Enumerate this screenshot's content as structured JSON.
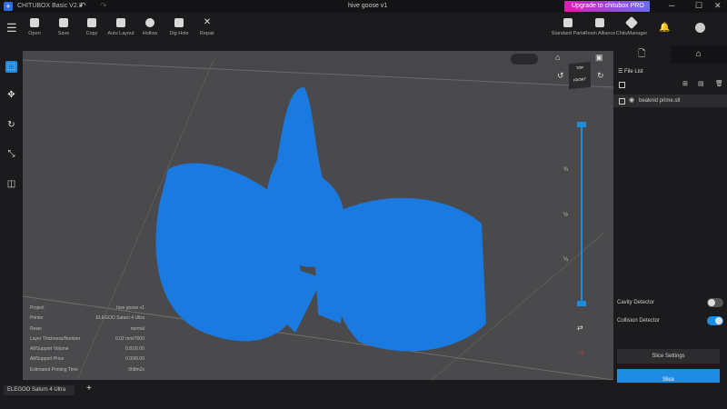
{
  "title_bar": {
    "app_name": "CHITUBOX Basic V2.3",
    "project": "hive goose v1",
    "upgrade": "Upgrade to chitubox PRO",
    "minimize": "─",
    "maximize": "☐",
    "close": "✕",
    "undo": "↶",
    "redo": "↷"
  },
  "toolbar": {
    "tools": [
      "Open",
      "Save",
      "Copy",
      "Auto Layout",
      "Hollow",
      "Dig Hole",
      "Repair"
    ],
    "right_tools": [
      "Standard Parts",
      "Resin Alliance",
      "ChituManager"
    ]
  },
  "viewcube": {
    "front": "FRONT",
    "top": "TOP"
  },
  "slider": {
    "marks": [
      "¾",
      "½",
      "¼"
    ]
  },
  "info": [
    {
      "label": "Project",
      "value": "hive goose v1"
    },
    {
      "label": "Printer",
      "value": "ELEGOO Saturn 4 Ultra"
    },
    {
      "label": "Resin",
      "value": "normal"
    },
    {
      "label": "Layer Thickness/Number",
      "value": "0.02 mm/7000"
    },
    {
      "label": "All/Support Volume",
      "value": "0.81/0.00"
    },
    {
      "label": "All/Support Price",
      "value": "0.00/0.00"
    },
    {
      "label": "Estimated Printing Time",
      "value": "0h8m2s"
    }
  ],
  "right_panel": {
    "file_list_title": "File List",
    "files": [
      "beaknid prime.stl"
    ],
    "cavity_detector": "Cavity Detector",
    "collision_detector": "Collision Detector",
    "slice_settings": "Slice Settings",
    "slice": "Slice"
  },
  "bottom": {
    "printer_tab": "ELEGOO Saturn 4 Ultra",
    "add": "+"
  },
  "colors": {
    "accent": "#1e8ce0",
    "model": "#1a7ae0"
  }
}
